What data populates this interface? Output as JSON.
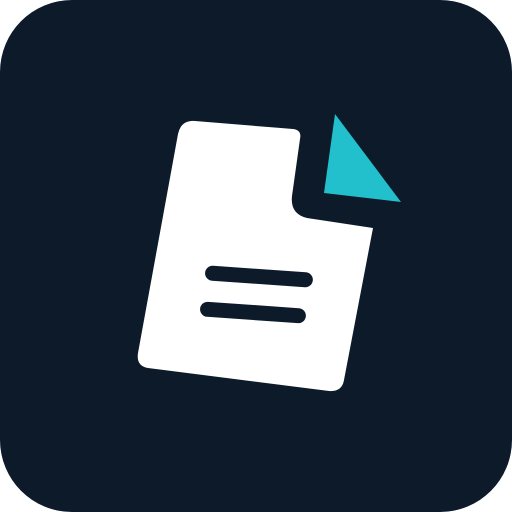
{
  "icon": {
    "name": "document-icon",
    "tile_color": "#0C1A29",
    "page_color": "#FFFFFF",
    "fold_color": "#22BFCC",
    "line_color": "#0C1A29"
  }
}
